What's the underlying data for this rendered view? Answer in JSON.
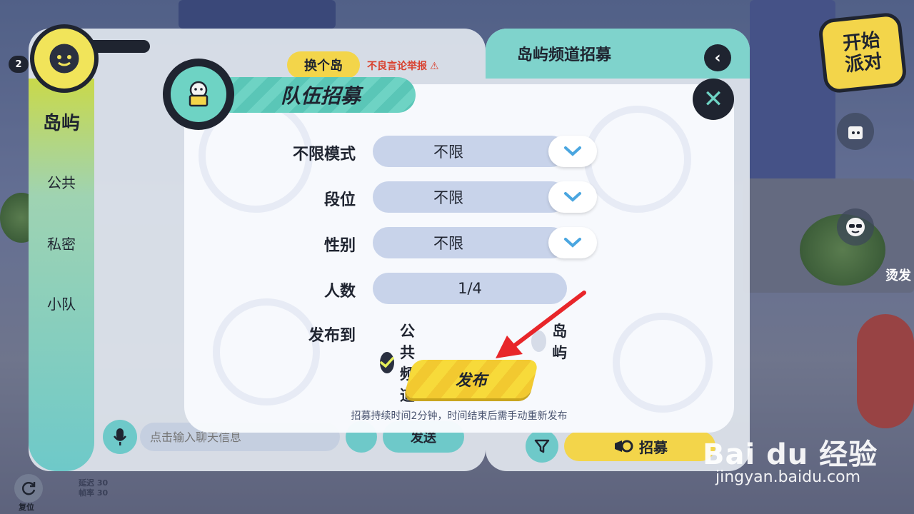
{
  "hud": {
    "level": "2",
    "start_party": "开始派对",
    "side_label": "烫发",
    "reset_label": "复位",
    "stats": {
      "latency_label": "延迟",
      "latency_value": "30",
      "fps_label": "帧率",
      "fps_value": "30"
    }
  },
  "chat_panel": {
    "tabs": [
      "岛屿",
      "公共",
      "私密",
      "小队"
    ],
    "active_tab": "岛屿",
    "switch_island_label": "换个岛",
    "report_label": "不良言论举报",
    "input_placeholder": "点击输入聊天信息",
    "send_label": "发送"
  },
  "channel_panel": {
    "title": "岛屿频道招募",
    "recruit_label": "招募"
  },
  "modal": {
    "title": "队伍招募",
    "fields": [
      {
        "label": "不限模式",
        "value": "不限",
        "type": "select"
      },
      {
        "label": "段位",
        "value": "不限",
        "type": "select"
      },
      {
        "label": "性别",
        "value": "不限",
        "type": "select"
      },
      {
        "label": "人数",
        "value": "1/4",
        "type": "display"
      }
    ],
    "publish_to_label": "发布到",
    "publish_options": [
      {
        "label": "公共频道",
        "selected": true
      },
      {
        "label": "岛屿",
        "selected": false
      }
    ],
    "publish_button": "发布",
    "hint": "招募持续时间2分钟，时间结束后需手动重新发布"
  },
  "watermark": {
    "brand": "Bai du 经验",
    "url": "jingyan.baidu.com"
  },
  "colors": {
    "accent_teal": "#6ed3c4",
    "accent_yellow": "#f3d54a",
    "dark": "#1f2430",
    "report_red": "#d9412f",
    "annotation_arrow": "#e8262a"
  }
}
